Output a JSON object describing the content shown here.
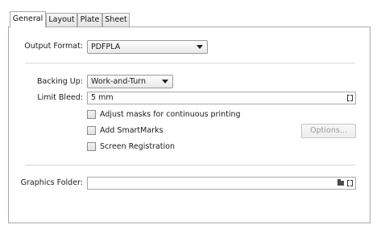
{
  "tabs": [
    {
      "label": "General"
    },
    {
      "label": "Layout"
    },
    {
      "label": "Plate"
    },
    {
      "label": "Sheet"
    }
  ],
  "output_format": {
    "label": "Output Format:",
    "value": "PDFPLA"
  },
  "backing_up": {
    "label": "Backing Up:",
    "value": "Work-and-Turn"
  },
  "limit_bleed": {
    "label": "Limit Bleed:",
    "value": "5 mm"
  },
  "options": {
    "adjust_masks": {
      "label": "Adjust masks for continuous printing",
      "checked": false
    },
    "add_smartmarks": {
      "label": "Add SmartMarks",
      "checked": false
    },
    "screen_registration": {
      "label": "Screen Registration",
      "checked": false
    }
  },
  "options_button": {
    "label": "Options...",
    "enabled": false
  },
  "graphics_folder": {
    "label": "Graphics Folder:",
    "value": ""
  },
  "icons": {
    "folder": "folder-icon",
    "variable": "bracket-icon",
    "dropdown": "chevron-down-icon"
  }
}
